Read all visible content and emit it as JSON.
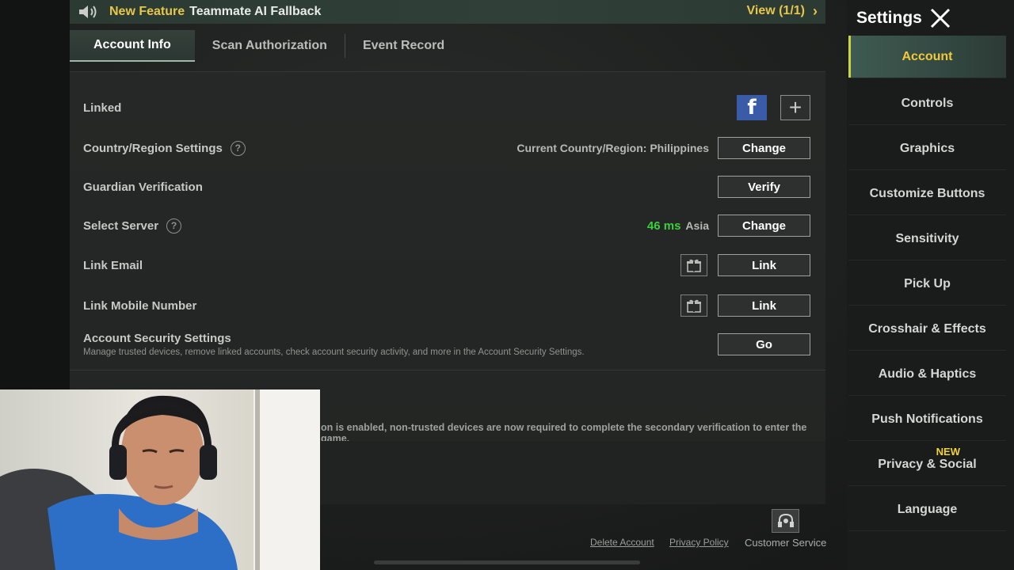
{
  "announcement": {
    "tag": "New Feature",
    "message": "Teammate AI Fallback",
    "view_label": "View (1/1)"
  },
  "tabs": [
    {
      "label": "Account Info",
      "active": true
    },
    {
      "label": "Scan Authorization",
      "active": false
    },
    {
      "label": "Event Record",
      "active": false
    }
  ],
  "rows": {
    "linked": {
      "label": "Linked"
    },
    "country": {
      "label": "Country/Region Settings",
      "value": "Current Country/Region: Philippines",
      "button": "Change"
    },
    "guardian": {
      "label": "Guardian Verification",
      "button": "Verify"
    },
    "server": {
      "label": "Select Server",
      "ping": "46 ms",
      "region": "Asia",
      "button": "Change"
    },
    "email": {
      "label": "Link Email",
      "button": "Link"
    },
    "mobile": {
      "label": "Link Mobile Number",
      "button": "Link"
    },
    "security": {
      "label": "Account Security Settings",
      "description": "Manage trusted devices, remove linked accounts, check account security activity, and more in the Account Security Settings.",
      "button": "Go"
    }
  },
  "partial_note": "on is enabled, non-trusted devices are now required to complete the secondary verification to enter the game.",
  "footer": {
    "delete_account": "Delete Account",
    "privacy_policy": "Privacy Policy",
    "customer_service": "Customer Service"
  },
  "sidebar": {
    "title": "Settings",
    "items": [
      {
        "label": "Account",
        "active": true
      },
      {
        "label": "Controls"
      },
      {
        "label": "Graphics"
      },
      {
        "label": "Customize Buttons"
      },
      {
        "label": "Sensitivity"
      },
      {
        "label": "Pick Up"
      },
      {
        "label": "Crosshair & Effects"
      },
      {
        "label": "Audio & Haptics"
      },
      {
        "label": "Push Notifications"
      },
      {
        "label": "Privacy & Social",
        "badge": "NEW"
      },
      {
        "label": "Language"
      }
    ]
  },
  "icons": {
    "speaker": "speaker-icon",
    "facebook": "facebook-icon",
    "add": "plus-icon",
    "help": "question-icon",
    "gift": "gift-icon",
    "close": "close-icon",
    "headset": "headset-icon"
  },
  "colors": {
    "accent_yellow": "#e8c64a",
    "ping_green": "#3ccf3c",
    "facebook_blue": "#3a5ca8",
    "active_tab": "#3f5b52"
  }
}
